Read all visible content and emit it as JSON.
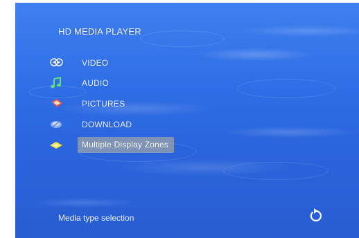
{
  "header": {
    "title": "HD MEDIA PLAYER"
  },
  "menu": {
    "items": [
      {
        "label": "VIDEO",
        "icon": "film-reel-icon"
      },
      {
        "label": "AUDIO",
        "icon": "music-note-icon"
      },
      {
        "label": "PICTURES",
        "icon": "pictures-icon"
      },
      {
        "label": "DOWNLOAD",
        "icon": "download-icon"
      },
      {
        "label": "Multiple Display Zones",
        "icon": "diamond-icon",
        "selected": true
      }
    ]
  },
  "status": {
    "text": "Media type selection",
    "icon": "return-icon"
  },
  "colors": {
    "background": "#2f6ee6",
    "highlight": "#969faa",
    "text": "#eef2fb"
  }
}
